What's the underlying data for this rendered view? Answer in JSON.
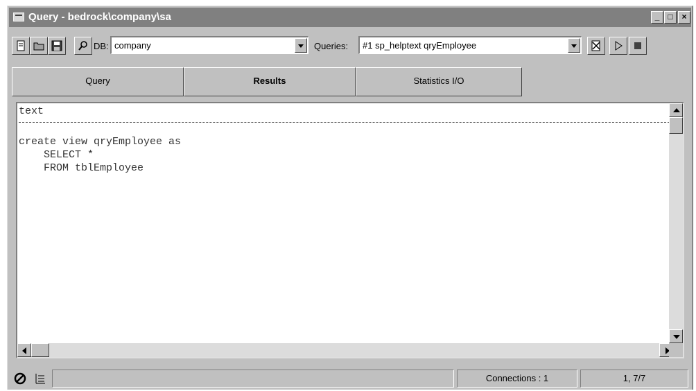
{
  "window": {
    "title": "Query - bedrock\\company\\sa",
    "controls": {
      "minimize": "_",
      "maximize": "□",
      "close": "×"
    }
  },
  "toolbar": {
    "icons": [
      "new-query-icon",
      "open-file-icon",
      "save-file-icon",
      "find-icon",
      "remove-query-icon",
      "execute-icon",
      "cancel-execution-icon"
    ],
    "db_label": "DB:",
    "db_value": "company",
    "queries_label": "Queries:",
    "queries_value": "#1 sp_helptext qryEmployee"
  },
  "tabs": [
    {
      "label": "Query",
      "active": false
    },
    {
      "label": "Results",
      "active": true
    },
    {
      "label": "Statistics I/O",
      "active": false
    }
  ],
  "results": {
    "column_header": "text",
    "lines": [
      "create view qryEmployee as",
      "    SELECT *",
      "    FROM tblEmployee"
    ]
  },
  "status": {
    "icons": [
      "no-entry-icon",
      "grid-results-icon"
    ],
    "connections": "Connections : 1",
    "position": "1, 7/7"
  }
}
